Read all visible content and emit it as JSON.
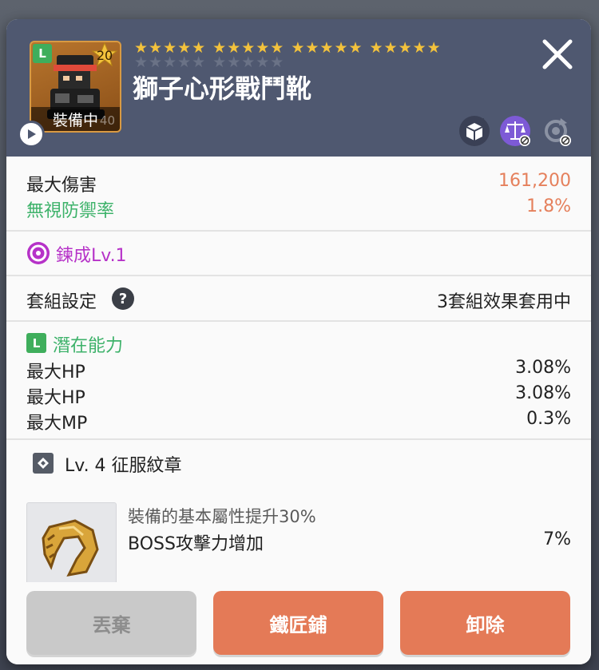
{
  "item": {
    "name": "獅子心形戰鬥靴",
    "grade_letter": "L",
    "star_force_level": "20",
    "equipped_label": "裝備中",
    "level_text": "40",
    "stars_filled_row": [
      "★★★★★",
      "★★★★★",
      "★★★★★",
      "★★★★★"
    ],
    "stars_empty_row": [
      "★★★★★",
      "★★★★★"
    ]
  },
  "header_icons": [
    "tradable-box-icon",
    "balance-scale-icon",
    "reset-cycle-icon"
  ],
  "stats": {
    "max_damage_label": "最大傷害",
    "max_damage_value": "161,200",
    "ignore_def_label": "無視防禦率",
    "ignore_def_value": "1.8%"
  },
  "refine": {
    "label": "鍊成Lv.1"
  },
  "set_bonus": {
    "label": "套組設定",
    "help": "?",
    "status": "3套組效果套用中"
  },
  "potential": {
    "grade_letter": "L",
    "title": "潛在能力",
    "lines": [
      {
        "label": "最大HP",
        "value": "3.08%"
      },
      {
        "label": "最大HP",
        "value": "3.08%"
      },
      {
        "label": "最大MP",
        "value": "0.3%"
      }
    ]
  },
  "emblem": {
    "title": "Lv. 4 征服紋章",
    "desc1": "裝備的基本屬性提升30%",
    "desc2": "BOSS攻擊力增加",
    "value": "7%"
  },
  "buttons": {
    "discard": "丟棄",
    "blacksmith": "鐵匠鋪",
    "unequip": "卸除"
  },
  "colors": {
    "header_bg": "#4f5870",
    "accent_orange": "#e47a57",
    "value_orange": "#e5805c",
    "green": "#3db26a",
    "purple": "#b632c8",
    "star_gold": "#f3c23c"
  }
}
